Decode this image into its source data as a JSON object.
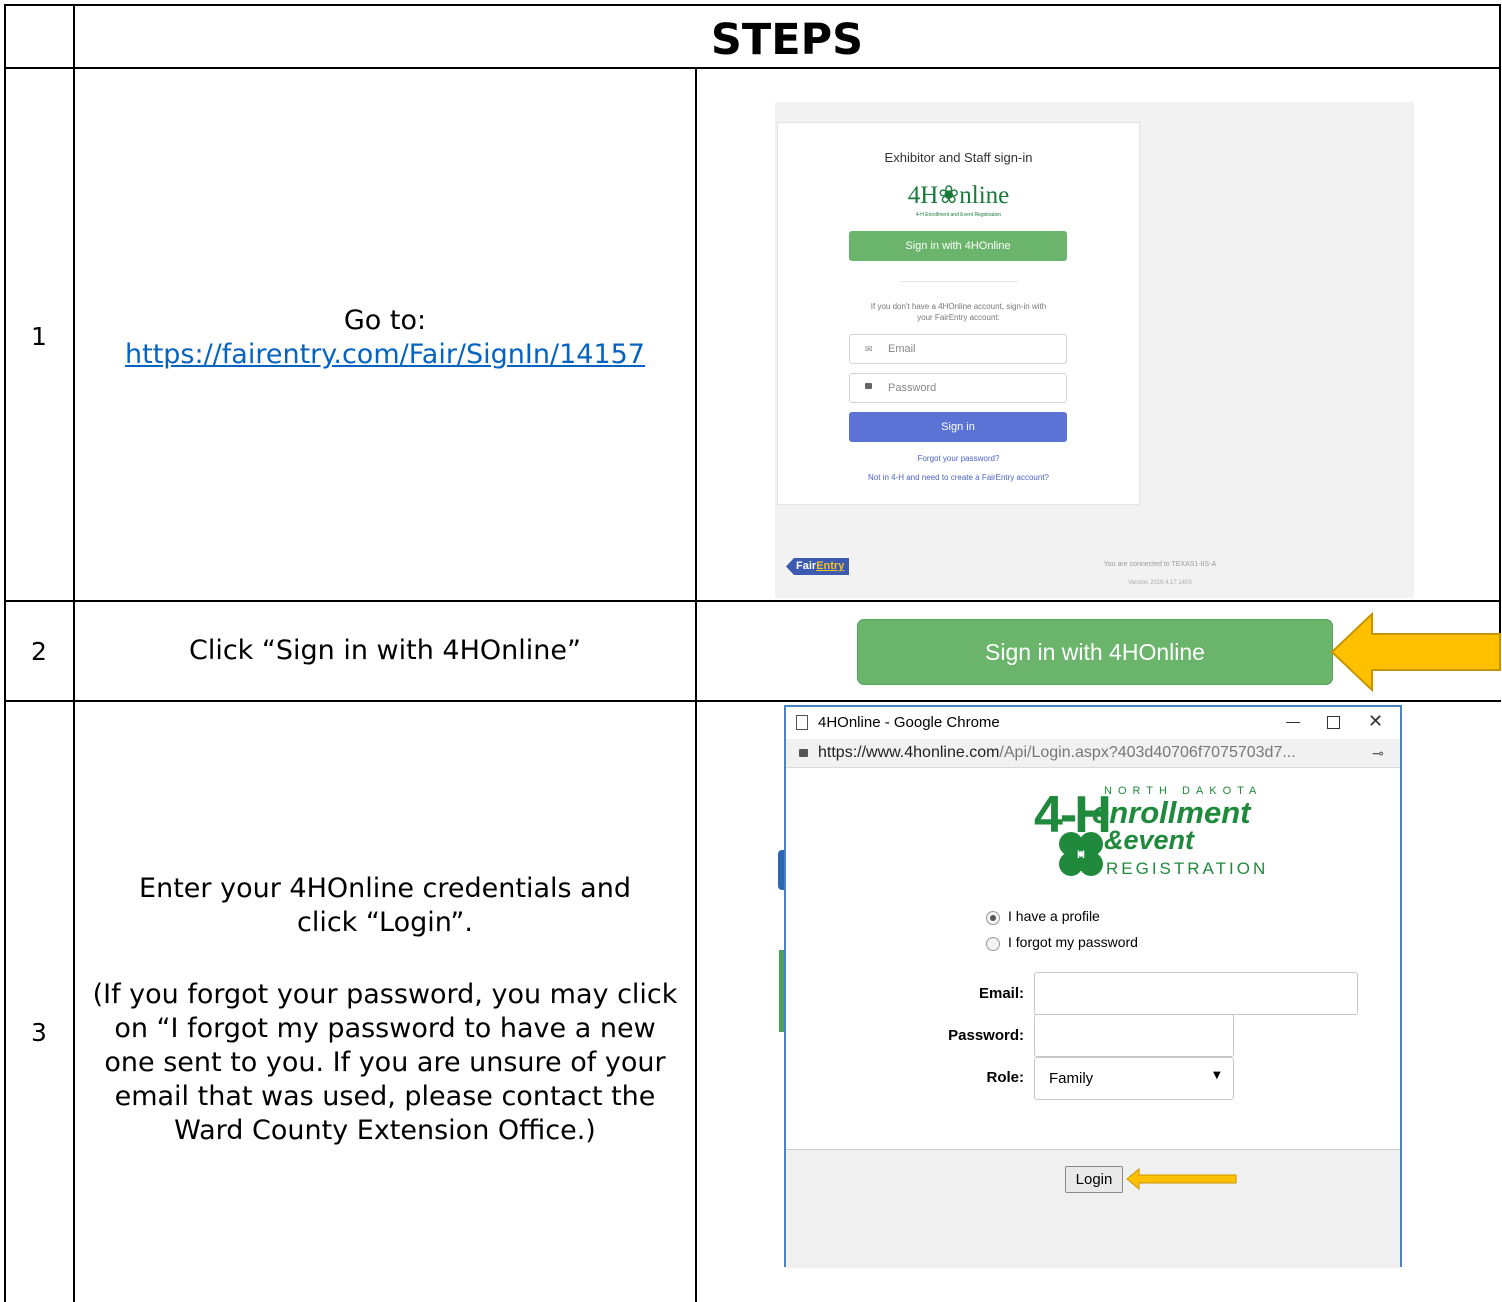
{
  "header": {
    "title": "STEPS"
  },
  "steps": [
    {
      "number": "1",
      "instruction_prefix": "Go to:",
      "link": "https://fairentry.com/Fair/SignIn/14157"
    },
    {
      "number": "2",
      "instruction": "Click “Sign in with 4HOnline”"
    },
    {
      "number": "3",
      "instruction_line1": "Enter your 4HOnline credentials and",
      "instruction_line2": "click “Login”.",
      "note_lines": [
        "(If you forgot your password, you may click",
        "on “I forgot my password to have a new",
        "one sent to you. If you are unsure of your",
        "email that was used, please contact the",
        "Ward County Extension Office.)"
      ]
    }
  ],
  "fairentry_signin": {
    "heading": "Exhibitor and Staff sign-in",
    "logo_text": "4H❀nline",
    "logo_tagline": "4-H Enrollment and Event Registration",
    "sign_in_4honline": "Sign in with 4HOnline",
    "alt_text_line1": "If you don't have a 4HOnline account, sign-in with",
    "alt_text_line2": "your FairEntry account:",
    "email_placeholder": "Email",
    "password_placeholder": "Password",
    "sign_in": "Sign in",
    "forgot": "Forgot your password?",
    "create": "Not in 4-H and need to create a FairEntry account?",
    "brand_prefix": "Fair",
    "brand_suffix": "Entry",
    "connected": "You are connected to TEXAS1-IIS-A",
    "version": "Version 2019.4.17.1403"
  },
  "step2_button": {
    "label": "Sign in with 4HOnline"
  },
  "popup": {
    "window_title": "4HOnline - Google Chrome",
    "url_host": "https://www.4honline.com",
    "url_path": "/Api/Login.aspx?403d40706f7075703d7...",
    "logo_state": "NORTH DAKOTA",
    "logo_line1": "enrollment",
    "logo_line2": "&event",
    "logo_line3": "REGISTRATION",
    "radio1": "I have a profile",
    "radio2": "I forgot my password",
    "email_label": "Email:",
    "password_label": "Password:",
    "role_label": "Role:",
    "role_value": "Family",
    "login": "Login"
  },
  "colors": {
    "arrow": "#ffc000",
    "green": "#6ab46b",
    "blue": "#5b73d4",
    "popup_border": "#4a84c4",
    "link": "#0563c1"
  }
}
